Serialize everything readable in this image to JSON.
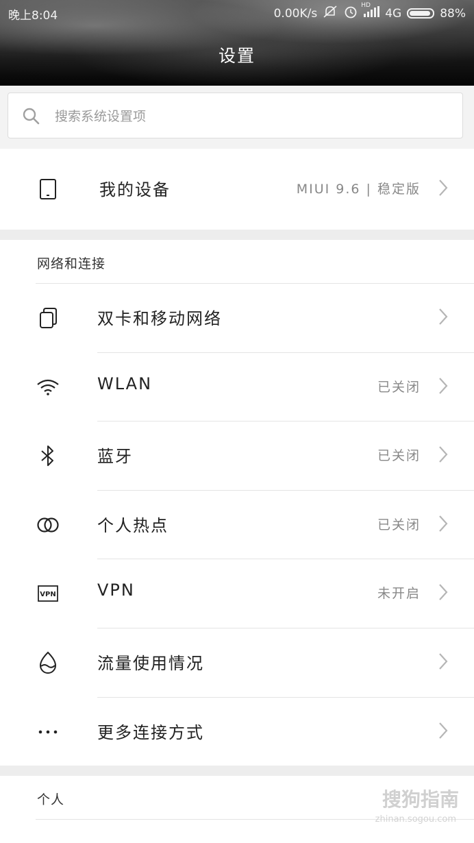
{
  "status_bar": {
    "time": "晚上8:04",
    "network_speed": "0.00K/s",
    "hd_label": "HD",
    "network_type": "4G",
    "battery": "88%"
  },
  "header": {
    "title": "设置"
  },
  "search": {
    "placeholder": "搜索系统设置项"
  },
  "my_device": {
    "label": "我的设备",
    "value": "MIUI 9.6 | 稳定版",
    "icon": "phone-icon"
  },
  "network_section": {
    "title": "网络和连接",
    "items": [
      {
        "label": "双卡和移动网络",
        "value": "",
        "icon": "dual-sim-icon"
      },
      {
        "label": "WLAN",
        "value": "已关闭",
        "icon": "wifi-icon"
      },
      {
        "label": "蓝牙",
        "value": "已关闭",
        "icon": "bluetooth-icon"
      },
      {
        "label": "个人热点",
        "value": "已关闭",
        "icon": "hotspot-icon"
      },
      {
        "label": "VPN",
        "value": "未开启",
        "icon": "vpn-icon"
      },
      {
        "label": "流量使用情况",
        "value": "",
        "icon": "data-usage-icon"
      },
      {
        "label": "更多连接方式",
        "value": "",
        "icon": "more-icon"
      }
    ]
  },
  "personal_section": {
    "title": "个人"
  },
  "watermark": {
    "text": "搜狗指南",
    "sub": "zhinan.sogou.com"
  }
}
